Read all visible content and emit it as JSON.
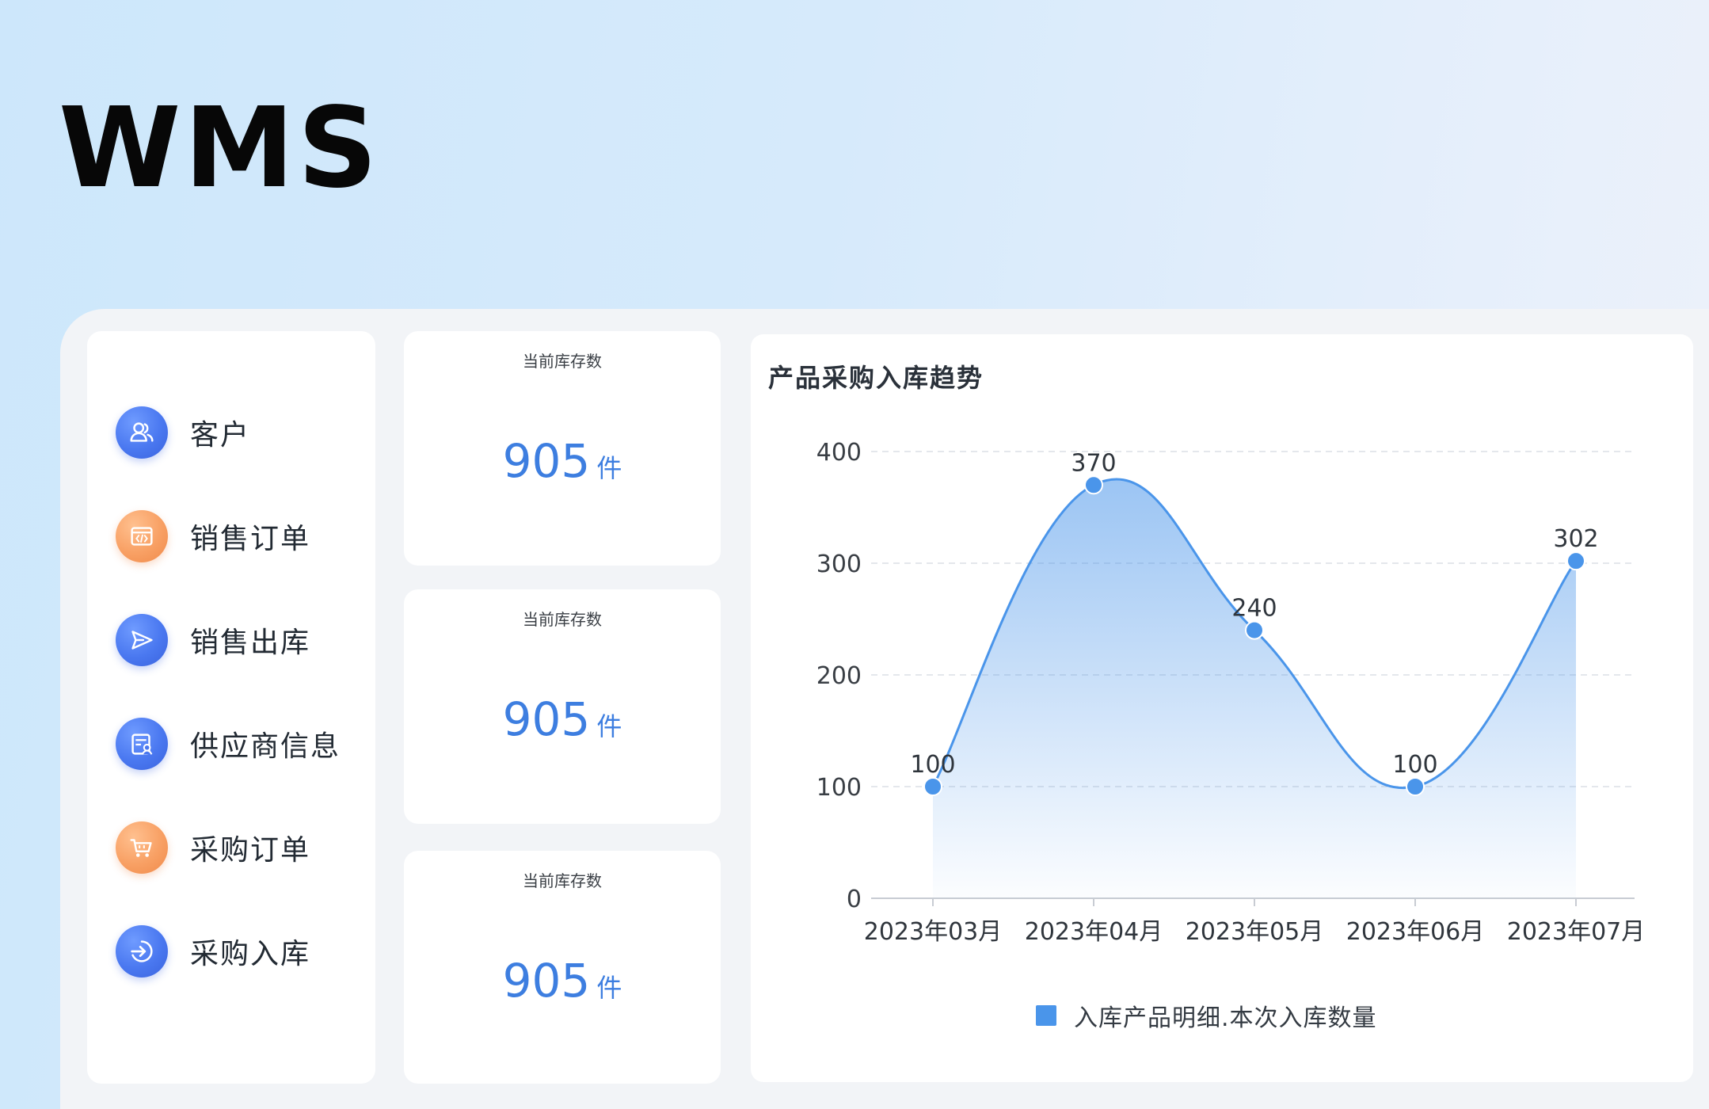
{
  "app": {
    "title": "WMS"
  },
  "sidebar": {
    "items": [
      {
        "label": "客户",
        "icon": "customer-icon",
        "color": "blue"
      },
      {
        "label": "销售订单",
        "icon": "sales-order-icon",
        "color": "orange"
      },
      {
        "label": "销售出库",
        "icon": "send-icon",
        "color": "blue"
      },
      {
        "label": "供应商信息",
        "icon": "supplier-info-icon",
        "color": "blue"
      },
      {
        "label": "采购订单",
        "icon": "cart-icon",
        "color": "orange"
      },
      {
        "label": "采购入库",
        "icon": "inbound-icon",
        "color": "blue"
      }
    ]
  },
  "stats": [
    {
      "label": "当前库存数",
      "value": "905",
      "unit": "件"
    },
    {
      "label": "当前库存数",
      "value": "905",
      "unit": "件"
    },
    {
      "label": "当前库存数",
      "value": "905",
      "unit": "件"
    }
  ],
  "colors": {
    "accent": "#3d7ee0",
    "series": "#4a95ea",
    "icon_blue": "#4a78f0",
    "icon_orange": "#f8a064"
  },
  "chart_panel": {
    "title": "产品采购入库趋势"
  },
  "chart_data": {
    "type": "area",
    "smooth": true,
    "title": "产品采购入库趋势",
    "categories": [
      "2023年03月",
      "2023年04月",
      "2023年05月",
      "2023年06月",
      "2023年07月"
    ],
    "series": [
      {
        "name": "入库产品明细.本次入库数量",
        "values": [
          100,
          370,
          240,
          100,
          302
        ]
      }
    ],
    "ylim": [
      0,
      400
    ],
    "yticks": [
      0,
      100,
      200,
      300,
      400
    ],
    "grid": "horizontal-dashed",
    "legend": "bottom-center",
    "data_labels": true
  }
}
